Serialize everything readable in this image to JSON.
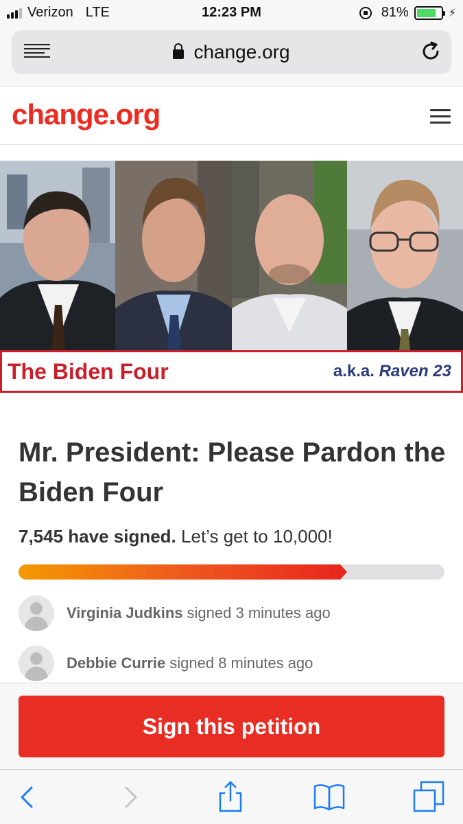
{
  "status_bar": {
    "carrier": "Verizon",
    "network": "LTE",
    "time": "12:23 PM",
    "battery_percent": "81%",
    "battery_level": 0.81
  },
  "browser": {
    "url": "change.org"
  },
  "site": {
    "logo": "change.org"
  },
  "hero": {
    "caption_left": "The Biden Four",
    "caption_right_prefix": "a.k.a.",
    "caption_right_name": "Raven 23"
  },
  "petition": {
    "title": "Mr. President: Please Pardon the Biden Four",
    "signed_count": "7,545 have signed.",
    "goal_text": "Let’s get to 10,000!",
    "progress": 0.7545
  },
  "signers": [
    {
      "name": "Virginia Judkins",
      "action": "signed 3 minutes ago"
    },
    {
      "name": "Debbie Currie",
      "action": "signed 8 minutes ago"
    }
  ],
  "cta": {
    "sign_label": "Sign this petition"
  },
  "colors": {
    "brand": "#ec2c22",
    "button": "#e82e24",
    "ios_blue": "#1b7cf5"
  },
  "icons": {
    "reader": "reader-icon",
    "reload": "reload-icon",
    "menu": "hamburger-icon",
    "back": "back-icon",
    "forward": "forward-icon",
    "share": "share-icon",
    "bookmarks": "bookmarks-icon",
    "tabs": "tabs-icon"
  }
}
